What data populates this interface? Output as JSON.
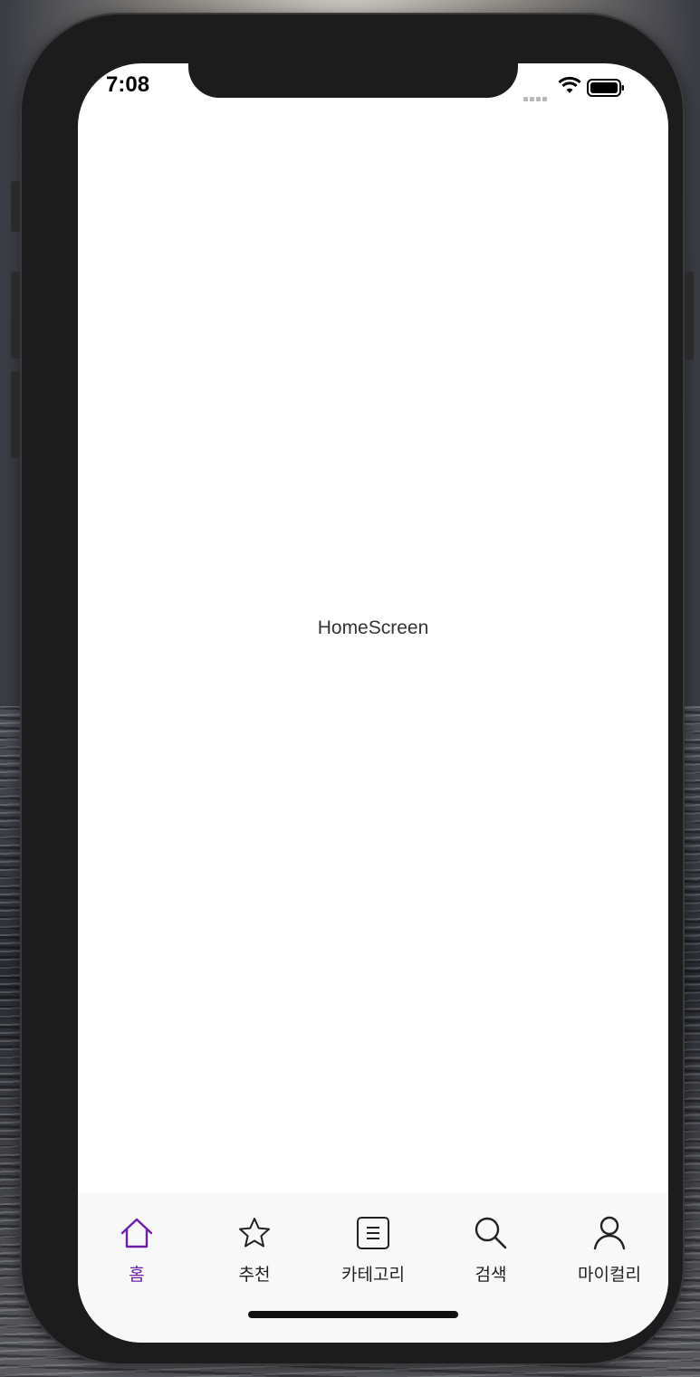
{
  "status_bar": {
    "time": "7:08"
  },
  "main": {
    "title": "HomeScreen"
  },
  "tabs": [
    {
      "label": "홈",
      "icon": "home-icon",
      "active": true
    },
    {
      "label": "추천",
      "icon": "star-icon",
      "active": false
    },
    {
      "label": "카테고리",
      "icon": "list-icon",
      "active": false
    },
    {
      "label": "검색",
      "icon": "search-icon",
      "active": false
    },
    {
      "label": "마이컬리",
      "icon": "user-icon",
      "active": false
    }
  ],
  "colors": {
    "accent": "#6c1fa6",
    "tab_bar_bg": "#f8f8f8",
    "screen_bg": "#ffffff",
    "frame": "#1c1c1c"
  }
}
